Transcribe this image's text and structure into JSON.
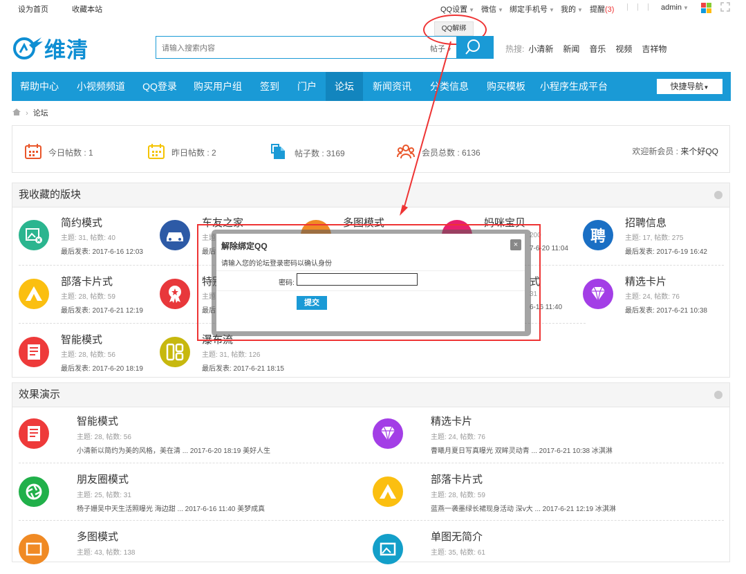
{
  "topbar": {
    "set_home": "设为首页",
    "bookmark": "收藏本站",
    "qq_settings": "QQ设置",
    "wechat": "微信",
    "bind_phone": "绑定手机号",
    "mine": "我的",
    "remind": "提醒",
    "remind_count": "(3)",
    "user": "admin",
    "qq_unbind_menu": "QQ解绑"
  },
  "header": {
    "logo_text": "维清",
    "search_placeholder": "请输入搜索内容",
    "search_scope": "帖子",
    "hot_label": "热搜:",
    "hot_items": [
      "小清新",
      "新闻",
      "音乐",
      "视频",
      "吉祥物"
    ]
  },
  "nav": {
    "items": [
      "帮助中心",
      "小视频频道",
      "QQ登录",
      "购买用户组",
      "签到",
      "门户",
      "论坛",
      "新闻资讯",
      "分类信息",
      "购买模板",
      "小程序生成平台"
    ],
    "active_index": 6,
    "quick_nav": "快捷导航"
  },
  "breadcrumb": {
    "current": "论坛"
  },
  "stats": {
    "today": "今日帖数 : 1",
    "yesterday": "昨日帖数 : 2",
    "posts": "帖子数 : 3169",
    "members": "会员总数 : 6136",
    "welcome_label": "欢迎新会员 : ",
    "welcome_name": "来个好QQ"
  },
  "fav_panel": {
    "title": "我收藏的版块",
    "forums": [
      {
        "name": "简约模式",
        "stats": "主题: 31, 帖数: 40",
        "last": "最后发表: 2017-6-16 12:03",
        "color": "#2bb58f",
        "icon": "image-icon"
      },
      {
        "name": "车友之家",
        "stats": "主题",
        "last": "最后",
        "color": "#2d5aa6",
        "icon": "car-icon"
      },
      {
        "name": "多图模式",
        "stats": "",
        "last": "",
        "color": "#f08a24",
        "icon": "gallery-icon"
      },
      {
        "name": "妈咪宝贝",
        "stats": "200",
        "last": "7-6-20 11:04",
        "color": "#e8206c",
        "icon": "baby-icon"
      },
      {
        "name": "招聘信息",
        "stats": "主题: 17, 帖数: 275",
        "last": "最后发表: 2017-6-19 16:42",
        "color": "#1a6fc4",
        "icon": "hire-icon"
      },
      {
        "name": "部落卡片式",
        "stats": "主题: 28, 帖数: 59",
        "last": "最后发表: 2017-6-21 12:19",
        "color": "#fbbf10",
        "icon": "tent-icon"
      },
      {
        "name": "特别",
        "stats": "主题",
        "last": "最后",
        "color": "#e8383b",
        "icon": "medal-icon"
      },
      {
        "name": "式",
        "stats": "31",
        "last": "6-16 11:40",
        "color": "#21b04a",
        "icon": "lens-icon"
      },
      {
        "name": "精选卡片",
        "stats": "主题: 24, 帖数: 76",
        "last": "最后发表: 2017-6-21 10:38",
        "color": "#a33ee6",
        "icon": "diamond-icon"
      },
      {
        "name": "智能模式",
        "stats": "主题: 28, 帖数: 56",
        "last": "最后发表: 2017-6-20 18:19",
        "color": "#ee3a3a",
        "icon": "doc-icon"
      },
      {
        "name": "瀑布流",
        "stats": "主题: 31, 帖数: 126",
        "last": "最后发表: 2017-6-21 18:15",
        "color": "#c7b80e",
        "icon": "grid-icon"
      }
    ]
  },
  "demo_panel": {
    "title": "效果演示",
    "items": [
      {
        "name": "智能模式",
        "stats": "主题: 28, 帖数: 56",
        "desc": "小清新以简约为美的风格，美在清 ... 2017-6-20 18:19 美好人生",
        "color": "#ee3a3a",
        "icon": "doc-icon"
      },
      {
        "name": "精选卡片",
        "stats": "主题: 24, 帖数: 76",
        "desc": "曹曦月夏日写真曝光 双眸灵动青 ... 2017-6-21 10:38 冰淇淋",
        "color": "#a33ee6",
        "icon": "diamond-icon"
      },
      {
        "name": "朋友圈模式",
        "stats": "主题: 25, 帖数: 31",
        "desc": "杨子姗吴中天生活照曝光 海边甜 ... 2017-6-16 11:40 美梦成真",
        "color": "#21b04a",
        "icon": "lens-icon"
      },
      {
        "name": "部落卡片式",
        "stats": "主题: 28, 帖数: 59",
        "desc": "蓝燕一袭墨绿长裙现身活动 深v大 ... 2017-6-21 12:19 冰淇淋",
        "color": "#fbbf10",
        "icon": "tent-icon"
      },
      {
        "name": "多图模式",
        "stats": "主题: 43, 帖数: 138",
        "desc": "",
        "color": "#f08a24",
        "icon": "gallery-icon"
      },
      {
        "name": "单图无简介",
        "stats": "主题: 35, 帖数: 61",
        "desc": "",
        "color": "#139fc9",
        "icon": "image-icon"
      }
    ]
  },
  "modal": {
    "title": "解除绑定QQ",
    "desc": "请输入您的论坛登录密码以确认身份",
    "password_label": "密码:",
    "submit": "提交",
    "close": "×"
  }
}
